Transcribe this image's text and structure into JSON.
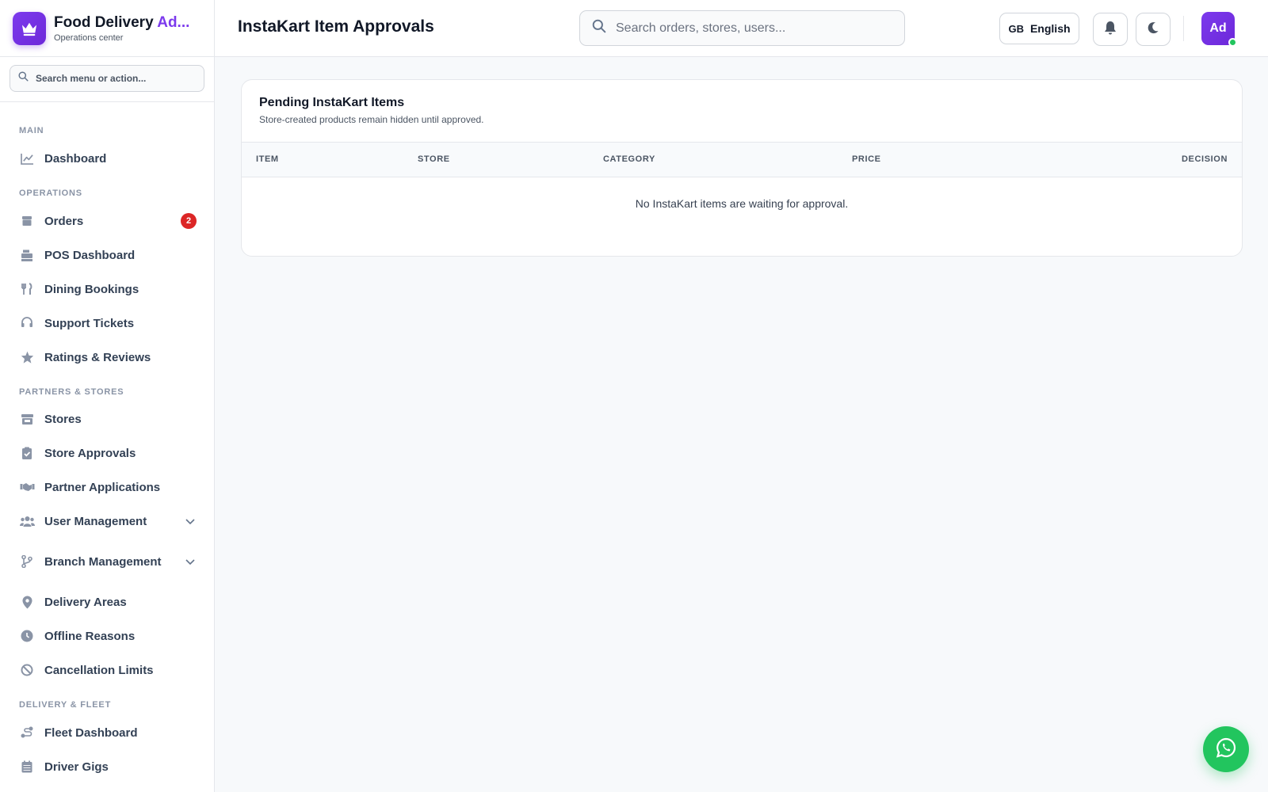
{
  "brand": {
    "title_main": "Food Delivery ",
    "title_accent": "Ad...",
    "subtitle": "Operations center"
  },
  "sidebar": {
    "search_placeholder": "Search menu or action...",
    "sections": {
      "main": "MAIN",
      "operations": "OPERATIONS",
      "partners": "PARTNERS & STORES",
      "delivery": "DELIVERY & FLEET"
    },
    "items": {
      "dashboard": "Dashboard",
      "orders": "Orders",
      "orders_badge": "2",
      "pos": "POS Dashboard",
      "dining": "Dining Bookings",
      "support": "Support Tickets",
      "ratings": "Ratings & Reviews",
      "stores": "Stores",
      "store_approvals": "Store Approvals",
      "partner_apps": "Partner Applications",
      "user_mgmt": "User Management",
      "branch_mgmt": "Branch Management",
      "delivery_areas": "Delivery Areas",
      "offline_reasons": "Offline Reasons",
      "cancellation_limits": "Cancellation Limits",
      "fleet_dashboard": "Fleet Dashboard",
      "driver_gigs": "Driver Gigs"
    }
  },
  "header": {
    "title": "InstaKart Item Approvals",
    "search_placeholder": "Search orders, stores, users...",
    "lang_code": "GB",
    "lang_label": "English",
    "avatar_initials": "Ad"
  },
  "card": {
    "title": "Pending InstaKart Items",
    "subtitle": "Store-created products remain hidden until approved.",
    "columns": [
      "ITEM",
      "STORE",
      "CATEGORY",
      "PRICE",
      "DECISION"
    ],
    "empty_message": "No InstaKart items are waiting for approval."
  },
  "colors": {
    "accent": "#7c3aed",
    "badge": "#dc2626",
    "whatsapp": "#22c55e"
  }
}
